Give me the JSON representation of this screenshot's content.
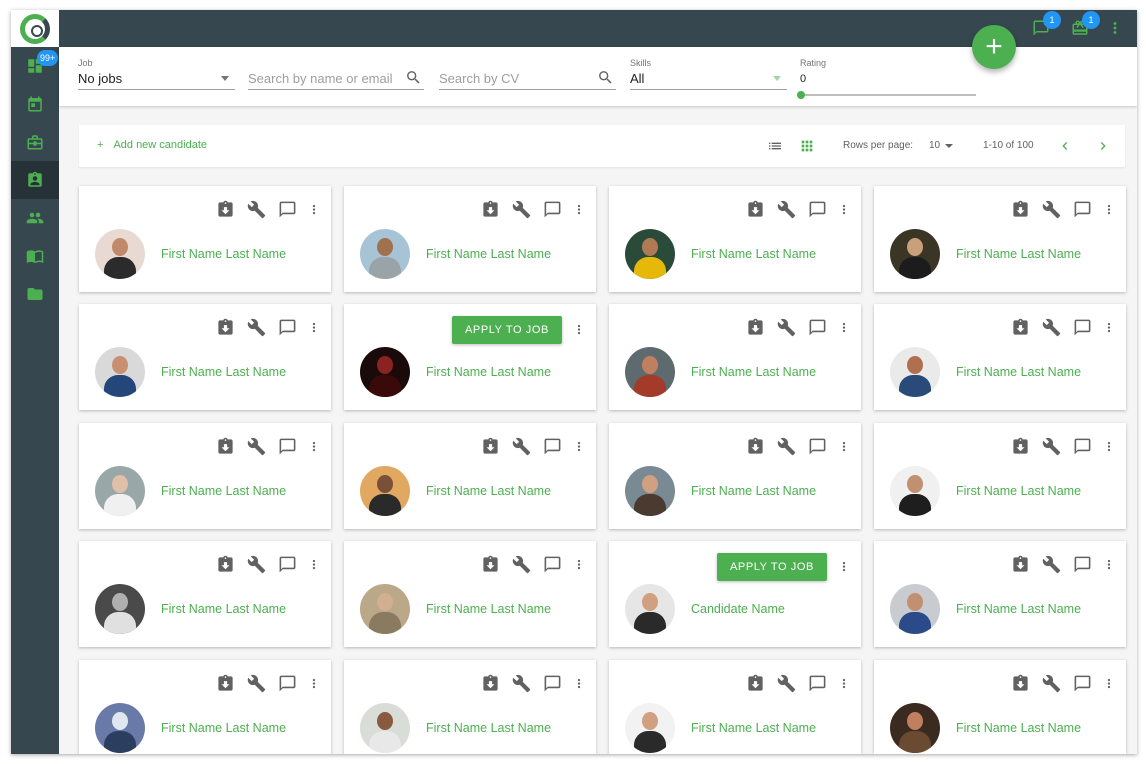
{
  "sidebar": {
    "badge": "99+",
    "items": [
      {
        "name": "dashboard",
        "icon": "dashboard-icon"
      },
      {
        "name": "calendar",
        "icon": "calendar-icon"
      },
      {
        "name": "jobs",
        "icon": "briefcase-icon"
      },
      {
        "name": "candidates",
        "icon": "candidate-badge-icon",
        "active": true
      },
      {
        "name": "users",
        "icon": "people-icon"
      },
      {
        "name": "library",
        "icon": "book-icon"
      },
      {
        "name": "folder",
        "icon": "folder-icon"
      }
    ]
  },
  "topbar": {
    "messages_badge": "1",
    "gifts_badge": "1",
    "messages_icon": "chat-icon",
    "gifts_icon": "gift-icon",
    "menu_icon": "more-vert-icon"
  },
  "filters": {
    "job": {
      "label": "Job",
      "value": "No jobs"
    },
    "search_name": {
      "placeholder": "Search by name or email"
    },
    "search_cv": {
      "placeholder": "Search by CV"
    },
    "skills": {
      "label": "Skills",
      "value": "All"
    },
    "rating": {
      "label": "Rating",
      "value": "0"
    }
  },
  "fab": {
    "label": "+"
  },
  "toolbar": {
    "add_icon": "+",
    "add_label": "Add new candidate",
    "rows_label": "Rows per page:",
    "rows_value": "10",
    "range": "1-10 of 100"
  },
  "actions": {
    "apply_label": "APPLY TO JOB"
  },
  "colors": {
    "accent": "#4caf50",
    "sidebar": "#37474f",
    "badge": "#2196f3"
  },
  "cards": [
    {
      "name": "First Name Last Name",
      "apply": false,
      "bg": "#e8d9d2",
      "skin": "#c08a6a",
      "shirt": "#2b2b2b"
    },
    {
      "name": "First Name Last Name",
      "apply": false,
      "bg": "#a7c4d6",
      "skin": "#a0714e",
      "shirt": "#9aa3a8"
    },
    {
      "name": "First Name Last Name",
      "apply": false,
      "bg": "#2a4a3a",
      "skin": "#b07a55",
      "shirt": "#e6b80a"
    },
    {
      "name": "First Name Last Name",
      "apply": false,
      "bg": "#3b3526",
      "skin": "#c9a07a",
      "shirt": "#1c1c1c"
    },
    {
      "name": "First Name Last Name",
      "apply": false,
      "bg": "#d9d9d9",
      "skin": "#c89070",
      "shirt": "#24467a"
    },
    {
      "name": "First Name Last Name",
      "apply": true,
      "bg": "#1a0a0a",
      "skin": "#8a2222",
      "shirt": "#3a0a0a"
    },
    {
      "name": "First Name Last Name",
      "apply": false,
      "bg": "#5d6a70",
      "skin": "#c08060",
      "shirt": "#a33a2a"
    },
    {
      "name": "First Name Last Name",
      "apply": false,
      "bg": "#eaeaea",
      "skin": "#b07050",
      "shirt": "#2a4b7a"
    },
    {
      "name": "First Name Last Name",
      "apply": false,
      "bg": "#9aa7a8",
      "skin": "#e0c0a8",
      "shirt": "#f0f0f0"
    },
    {
      "name": "First Name Last Name",
      "apply": false,
      "bg": "#e0a860",
      "skin": "#7a5038",
      "shirt": "#2a2a2a"
    },
    {
      "name": "First Name Last Name",
      "apply": false,
      "bg": "#7a8a94",
      "skin": "#d0a080",
      "shirt": "#4a3a30"
    },
    {
      "name": "First Name Last Name",
      "apply": false,
      "bg": "#f0f0f0",
      "skin": "#c09070",
      "shirt": "#1e1e1e"
    },
    {
      "name": "First Name Last Name",
      "apply": false,
      "bg": "#4a4a4a",
      "skin": "#b0b0b0",
      "shirt": "#e0e0e0"
    },
    {
      "name": "First Name Last Name",
      "apply": false,
      "bg": "#bba888",
      "skin": "#d0b090",
      "shirt": "#8a7a60"
    },
    {
      "name": "Candidate Name",
      "apply": true,
      "bg": "#e6e6e6",
      "skin": "#d0a080",
      "shirt": "#2a2a2a"
    },
    {
      "name": "First Name Last Name",
      "apply": false,
      "bg": "#c8ccd0",
      "skin": "#c09070",
      "shirt": "#2a4a8a"
    },
    {
      "name": "First Name Last Name",
      "apply": false,
      "bg": "#6a7aa8",
      "skin": "#dfe8f0",
      "shirt": "#2c3e60"
    },
    {
      "name": "First Name Last Name",
      "apply": false,
      "bg": "#d8ddd8",
      "skin": "#8a5a40",
      "shirt": "#e8e8e8"
    },
    {
      "name": "First Name Last Name",
      "apply": false,
      "bg": "#f2f2f2",
      "skin": "#d0a080",
      "shirt": "#2a2a2a"
    },
    {
      "name": "First Name Last Name",
      "apply": false,
      "bg": "#3a2a20",
      "skin": "#c08060",
      "shirt": "#6a4a30"
    }
  ]
}
